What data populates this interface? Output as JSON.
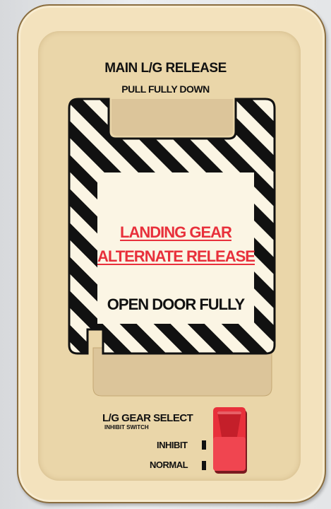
{
  "placard": {
    "header_line1": "MAIN L/G RELEASE",
    "header_line2": "PULL FULLY DOWN"
  },
  "door": {
    "label_line1": "LANDING GEAR",
    "label_line2": "ALTERNATE RELEASE",
    "label_line3": "OPEN DOOR FULLY"
  },
  "switch": {
    "title": "L/G GEAR SELECT",
    "subtitle": "INHIBIT SWITCH",
    "position_inhibit": "INHIBIT",
    "position_normal": "NORMAL"
  },
  "colors": {
    "placard_bg": "#f3e2bd",
    "warning_red": "#e8303b",
    "stripe_black": "#111111",
    "door_panel": "#fbf5e4",
    "toggle_red": "#e8303b"
  }
}
